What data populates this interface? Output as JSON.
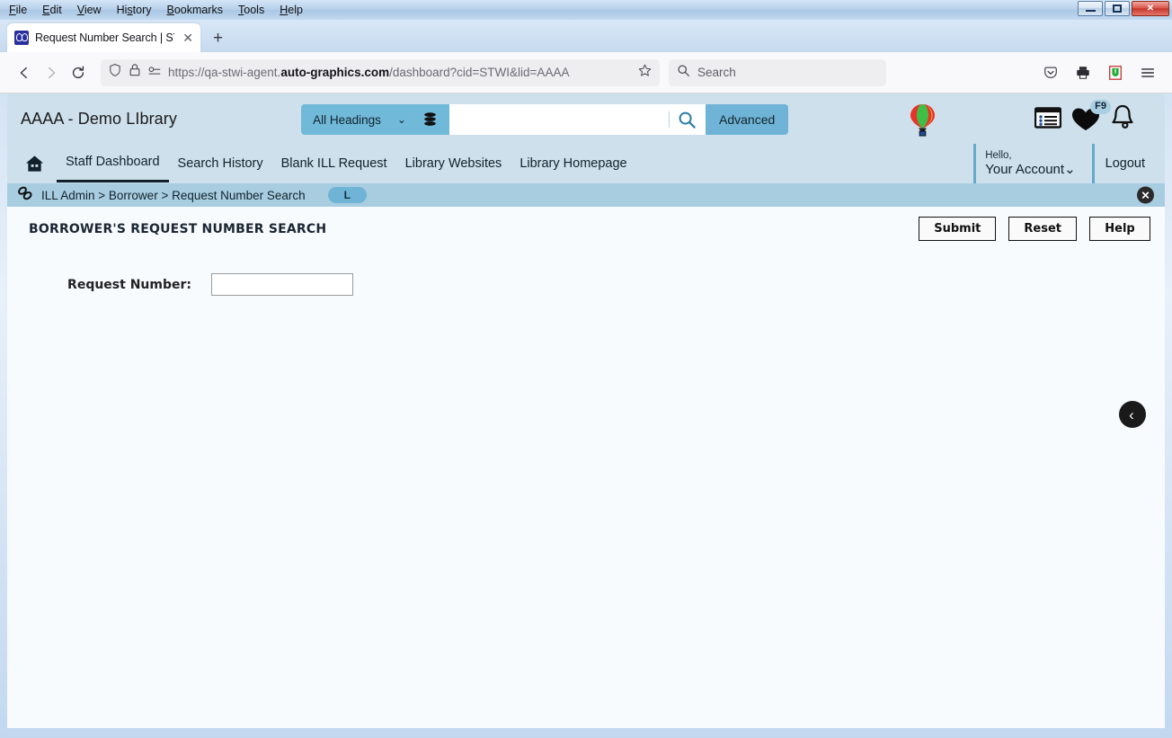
{
  "browser": {
    "menus": [
      "File",
      "Edit",
      "View",
      "History",
      "Bookmarks",
      "Tools",
      "Help"
    ],
    "window_controls": {
      "minimize": "—",
      "maximize": "□",
      "close": "✕"
    },
    "tab": {
      "title": "Request Number Search | STWI",
      "close": "✕",
      "favicon": "stwi-favicon"
    },
    "newtab_label": "+",
    "url_prefix": "https://qa-stwi-agent.",
    "url_domain": "auto-graphics.com",
    "url_suffix": "/dashboard?cid=STWI&lid=AAAA",
    "search_placeholder": "Search"
  },
  "app": {
    "brand": "AAAA - Demo LIbrary",
    "scope_label": "All Headings",
    "query_value": "",
    "advanced_label": "Advanced",
    "f9_badge": "F9",
    "nav": [
      {
        "label": "Staff Dashboard",
        "active": true
      },
      {
        "label": "Search History",
        "active": false
      },
      {
        "label": "Blank ILL Request",
        "active": false
      },
      {
        "label": "Library Websites",
        "active": false
      },
      {
        "label": "Library Homepage",
        "active": false
      }
    ],
    "account": {
      "hello": "Hello,",
      "name": "Your Account⌄"
    },
    "logout": "Logout",
    "breadcrumb": "ILL Admin > Borrower > Request Number Search",
    "breadcrumb_pill": "L",
    "breadcrumb_close": "✕"
  },
  "page": {
    "title": "BORROWER'S REQUEST NUMBER SEARCH",
    "buttons": {
      "submit": "Submit",
      "reset": "Reset",
      "help": "Help"
    },
    "field_label": "Request Number:",
    "field_value": "",
    "field_placeholder": "",
    "back_arrow": "‹"
  }
}
